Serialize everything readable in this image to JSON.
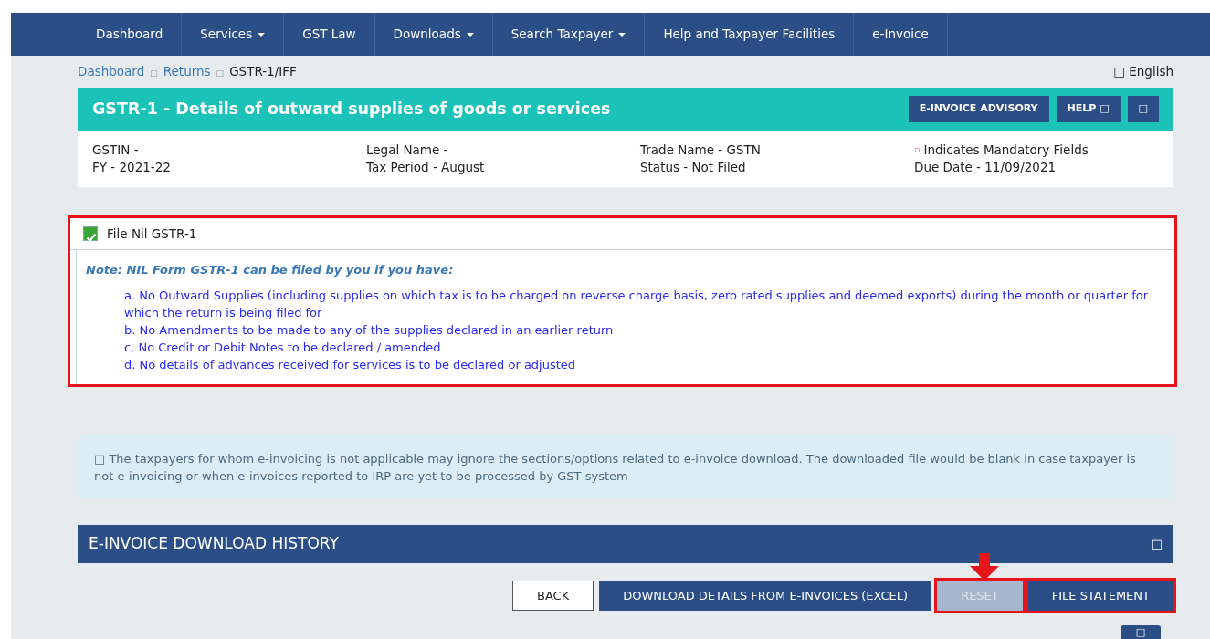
{
  "nav": [
    {
      "label": "Dashboard",
      "dropdown": false
    },
    {
      "label": "Services",
      "dropdown": true
    },
    {
      "label": "GST Law",
      "dropdown": false
    },
    {
      "label": "Downloads",
      "dropdown": true
    },
    {
      "label": "Search Taxpayer",
      "dropdown": true
    },
    {
      "label": "Help and Taxpayer Facilities",
      "dropdown": false
    },
    {
      "label": "e-Invoice",
      "dropdown": false
    }
  ],
  "breadcrumb": {
    "items": [
      {
        "label": "Dashboard",
        "separator": "□"
      },
      {
        "label": "Returns",
        "separator": "□"
      },
      {
        "label": "GSTR-1/IFF"
      }
    ],
    "language": "□ English"
  },
  "header": {
    "title": "GSTR-1 - Details of outward supplies of goods or services",
    "buttons": [
      {
        "label": "E-INVOICE ADVISORY"
      },
      {
        "label": "HELP □"
      },
      {
        "label": "□"
      }
    ]
  },
  "info": [
    [
      "GSTIN -",
      "FY - 2021-22"
    ],
    [
      "Legal Name -",
      "Tax Period - August"
    ],
    [
      "Trade Name - GSTN",
      "Status - Not Filed"
    ],
    [
      "Indicates Mandatory Fields",
      "Due Date - 11/09/2021"
    ]
  ],
  "mandatory_mark": "▫",
  "nil_panel": {
    "highlighted": true,
    "checkbox": {
      "label": "File Nil GSTR-1",
      "checked": true
    },
    "note": "Note: NIL Form GSTR-1 can be filed by you if you have:",
    "items": [
      "a. No Outward Supplies (including supplies on which tax is to be charged on reverse charge basis, zero rated supplies and deemed exports) during the month or quarter for which the return is being filed for",
      "b. No Amendments to be made to any of the supplies declared in an earlier return",
      "c. No Credit or Debit Notes to be declared / amended",
      "d. No details of advances received for services is to be declared or adjusted"
    ]
  },
  "alert": "□ The taxpayers for whom e-invoicing is not applicable may ignore the sections/options related to e-invoice download. The downloaded file would be blank in case taxpayer is not e-invoicing or when e-invoices reported to IRP are yet to be processed by GST system",
  "history": {
    "title": "E-INVOICE DOWNLOAD HISTORY",
    "toggle": "□"
  },
  "actions": [
    {
      "label": "BACK",
      "kind": "outline",
      "disabled": false,
      "highlighted": false,
      "arrow": false
    },
    {
      "label": "DOWNLOAD DETAILS FROM E-INVOICES (EXCEL)",
      "kind": "primary",
      "disabled": false,
      "highlighted": false,
      "arrow": false
    },
    {
      "label": "RESET",
      "kind": "primary",
      "disabled": true,
      "highlighted": true,
      "arrow": true
    },
    {
      "label": "FILE STATEMENT",
      "kind": "primary",
      "disabled": false,
      "highlighted": true,
      "arrow": false
    }
  ],
  "back_to_top": "□"
}
